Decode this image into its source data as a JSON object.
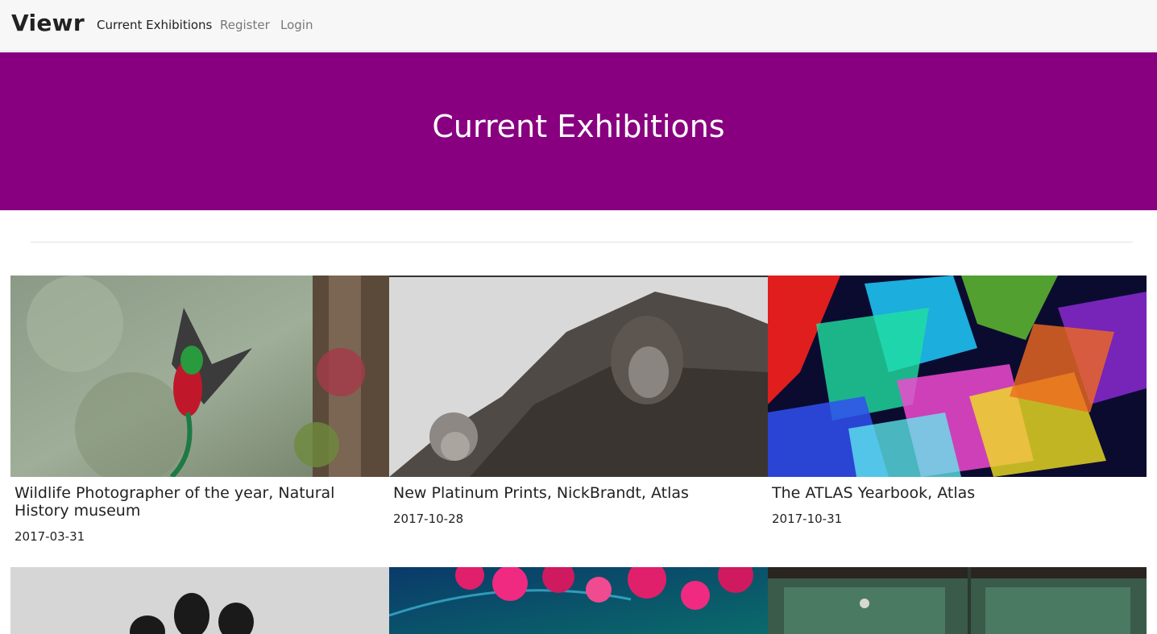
{
  "app": {
    "brand": "Viewr"
  },
  "nav": {
    "items": [
      {
        "label": "Current Exhibitions",
        "active": true
      },
      {
        "label": "Register",
        "active": false
      },
      {
        "label": "Login",
        "active": false
      }
    ]
  },
  "hero": {
    "title": "Current Exhibitions",
    "background": "#880080"
  },
  "exhibitions": [
    {
      "title": "Wildlife Photographer of the year, Natural History museum",
      "date": "2017-03-31"
    },
    {
      "title": "New Platinum Prints, NickBrandt, Atlas",
      "date": "2017-10-28"
    },
    {
      "title": "The ATLAS Yearbook, Atlas",
      "date": "2017-10-31"
    }
  ]
}
